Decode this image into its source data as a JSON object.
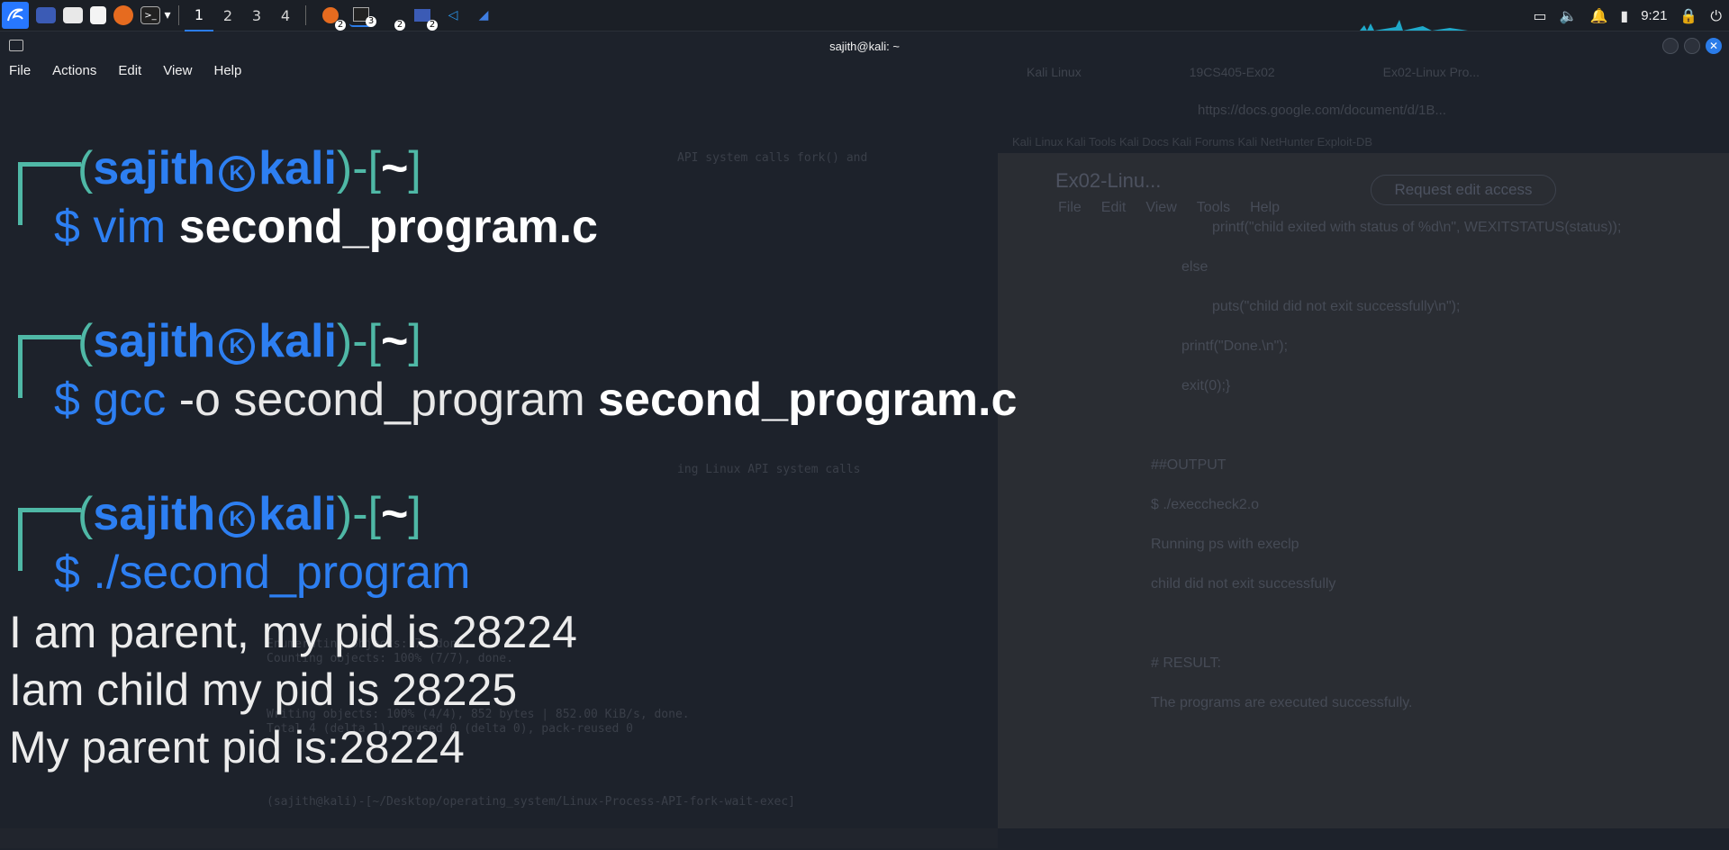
{
  "taskbar": {
    "workspaces": [
      "1",
      "2",
      "3",
      "4"
    ],
    "active_workspace": "1",
    "badges": [
      "2",
      "3",
      "2",
      "2"
    ],
    "clock": "9:21"
  },
  "window": {
    "title": "sajith@kali: ~"
  },
  "menu": [
    "File",
    "Actions",
    "Edit",
    "View",
    "Help"
  ],
  "terminal": {
    "user": "sajith",
    "host": "kali",
    "cwd": "~",
    "commands": [
      {
        "cmd": "vim",
        "args": "",
        "file": "second_program.c"
      },
      {
        "cmd": "gcc",
        "args": " -o second_program ",
        "file": "second_program.c"
      },
      {
        "cmd": "./second_program",
        "args": "",
        "file": ""
      }
    ],
    "output": [
      "I am parent, my pid is 28224",
      "Iam child my pid is 28225",
      "My parent pid is:28224"
    ]
  },
  "background": {
    "doc_title": "Ex02-Linu...",
    "doc_menu": [
      "File",
      "Edit",
      "View",
      "Tools",
      "Help"
    ],
    "request_button": "Request edit access",
    "doc_lines": [
      "printf(\"child exited with status of %d\\n\", WEXITSTATUS(status));",
      "else",
      "puts(\"child did not exit successfully\\n\");",
      "printf(\"Done.\\n\");",
      "exit(0);}",
      "##OUTPUT",
      "$ ./execcheck2.o",
      "Running ps with execlp",
      "child did not exit successfully",
      "# RESULT:",
      "The programs are executed successfully."
    ],
    "tabs": [
      "Kali Linux",
      "19CS405-Ex02",
      "Ex02-Linux Pro..."
    ],
    "url": "https://docs.google.com/document/d/1B...",
    "bookmarks": "Kali Linux   Kali Tools   Kali Docs   Kali Forums   Kali NetHunter   Exploit-DB",
    "vscode_lines": [
      "API system calls fork() and",
      "ing Linux API system calls",
      "Enumerating objects: 7, done.",
      "Counting objects: 100% (7/7), done.",
      "Writing objects: 100% (4/4), 852 bytes | 852.00 KiB/s, done.",
      "Total 4 (delta 1), reused 0 (delta 0), pack-reused 0",
      "(sajith@kali)-[~/Desktop/operating_system/Linux-Process-API-fork-wait-exec]"
    ]
  }
}
